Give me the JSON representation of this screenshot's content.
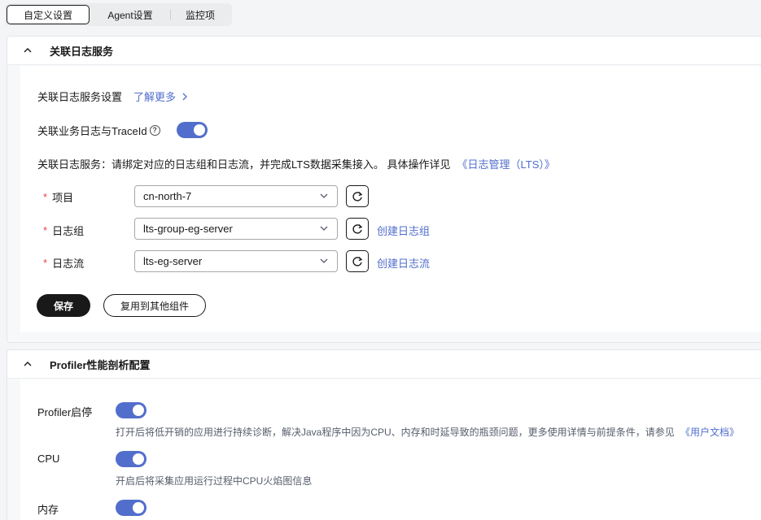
{
  "tabs": [
    {
      "label": "自定义设置",
      "active": true
    },
    {
      "label": "Agent设置",
      "active": false
    },
    {
      "label": "监控项",
      "active": false
    }
  ],
  "log_panel": {
    "title": "关联日志服务",
    "settings_label": "关联日志服务设置",
    "learn_more": "了解更多",
    "trace_label": "关联业务日志与TraceId",
    "trace_enabled": true,
    "desc_text": "关联日志服务：请绑定对应的日志组和日志流，并完成LTS数据采集接入。 具体操作详见",
    "desc_link": "《日志管理（LTS）》",
    "fields": [
      {
        "label": "项目",
        "value": "cn-north-7",
        "create_link": ""
      },
      {
        "label": "日志组",
        "value": "lts-group-eg-server",
        "create_link": "创建日志组"
      },
      {
        "label": "日志流",
        "value": "lts-eg-server",
        "create_link": "创建日志流"
      }
    ],
    "save_label": "保存",
    "reuse_label": "复用到其他组件"
  },
  "profiler_panel": {
    "title": "Profiler性能剖析配置",
    "items": [
      {
        "label": "Profiler启停",
        "enabled": true,
        "desc": "打开后将低开销的应用进行持续诊断，解决Java程序中因为CPU、内存和时延导致的瓶颈问题，更多使用详情与前提条件，请参见",
        "desc_link": "《用户文档》"
      },
      {
        "label": "CPU",
        "enabled": true,
        "desc": "开启后将采集应用运行过程中CPU火焰图信息",
        "desc_link": ""
      },
      {
        "label": "内存",
        "enabled": true,
        "desc": "",
        "desc_link": ""
      }
    ]
  },
  "colors": {
    "accent": "#526ecc",
    "required": "#e54545",
    "primary_button": "#191919"
  }
}
